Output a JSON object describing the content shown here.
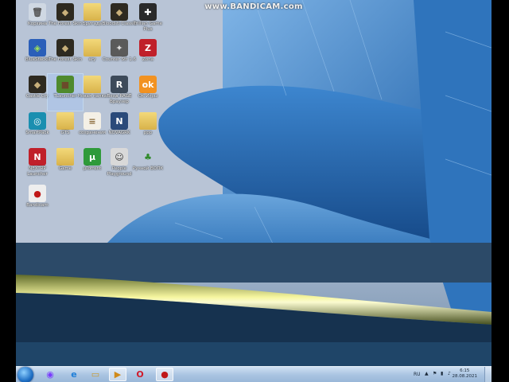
{
  "watermark": "www.BANDICAM.com",
  "desktop_icons": [
    {
      "label": "Корзина",
      "icon": "recycle-bin-icon"
    },
    {
      "label": "The Forest Skin",
      "icon": "game-icon"
    },
    {
      "label": "Бригада",
      "icon": "folder-icon"
    },
    {
      "label": "Bloodsti Classic",
      "icon": "game-icon"
    },
    {
      "label": "Trillian Game Plus",
      "icon": "gamepad-icon"
    },
    {
      "label": "BlueStacks",
      "icon": "bluestacks-icon"
    },
    {
      "label": "The Forest Skin",
      "icon": "game-icon"
    },
    {
      "label": "ary",
      "icon": "folder-icon"
    },
    {
      "label": "Counter Str 1.6",
      "icon": "counter-strike-icon"
    },
    {
      "label": "Zona",
      "icon": "zona-icon"
    },
    {
      "label": "Castle Cry",
      "icon": "game-icon"
    },
    {
      "label": "TLauncher",
      "icon": "minecraft-icon"
    },
    {
      "label": "Новая папка",
      "icon": "folder-icon"
    },
    {
      "label": "Вход RAGE Браузер",
      "icon": "rage-icon"
    },
    {
      "label": "OK Игры",
      "icon": "ok-icon"
    },
    {
      "label": "SmartPack",
      "icon": "smartpack-icon"
    },
    {
      "label": "GTS",
      "icon": "folder-icon"
    },
    {
      "label": "сохранения",
      "icon": "file-icon"
    },
    {
      "label": "NOVAGRK",
      "icon": "nova-icon"
    },
    {
      "label": "ppp",
      "icon": "folder-icon"
    },
    {
      "label": "NEXTRP Launcher",
      "icon": "nextrp-icon"
    },
    {
      "label": "Game",
      "icon": "folder-icon"
    },
    {
      "label": "µTorrent",
      "icon": "utorrent-icon"
    },
    {
      "label": "People Playground",
      "icon": "people-playground-icon"
    },
    {
      "label": "Ручной ВОЛК",
      "icon": "tree-icon"
    },
    {
      "label": "Bandicam",
      "icon": "bandicam-icon"
    }
  ],
  "taskbar": {
    "items": [
      {
        "icon": "alice-icon",
        "active": false
      },
      {
        "icon": "ie-icon",
        "active": false
      },
      {
        "icon": "explorer-icon",
        "active": false
      },
      {
        "icon": "media-player-icon",
        "active": true
      },
      {
        "icon": "opera-icon",
        "active": false
      },
      {
        "icon": "bandicam-icon",
        "active": true
      }
    ],
    "language": "RU",
    "time": "6:15",
    "date": "28.08.2021"
  }
}
